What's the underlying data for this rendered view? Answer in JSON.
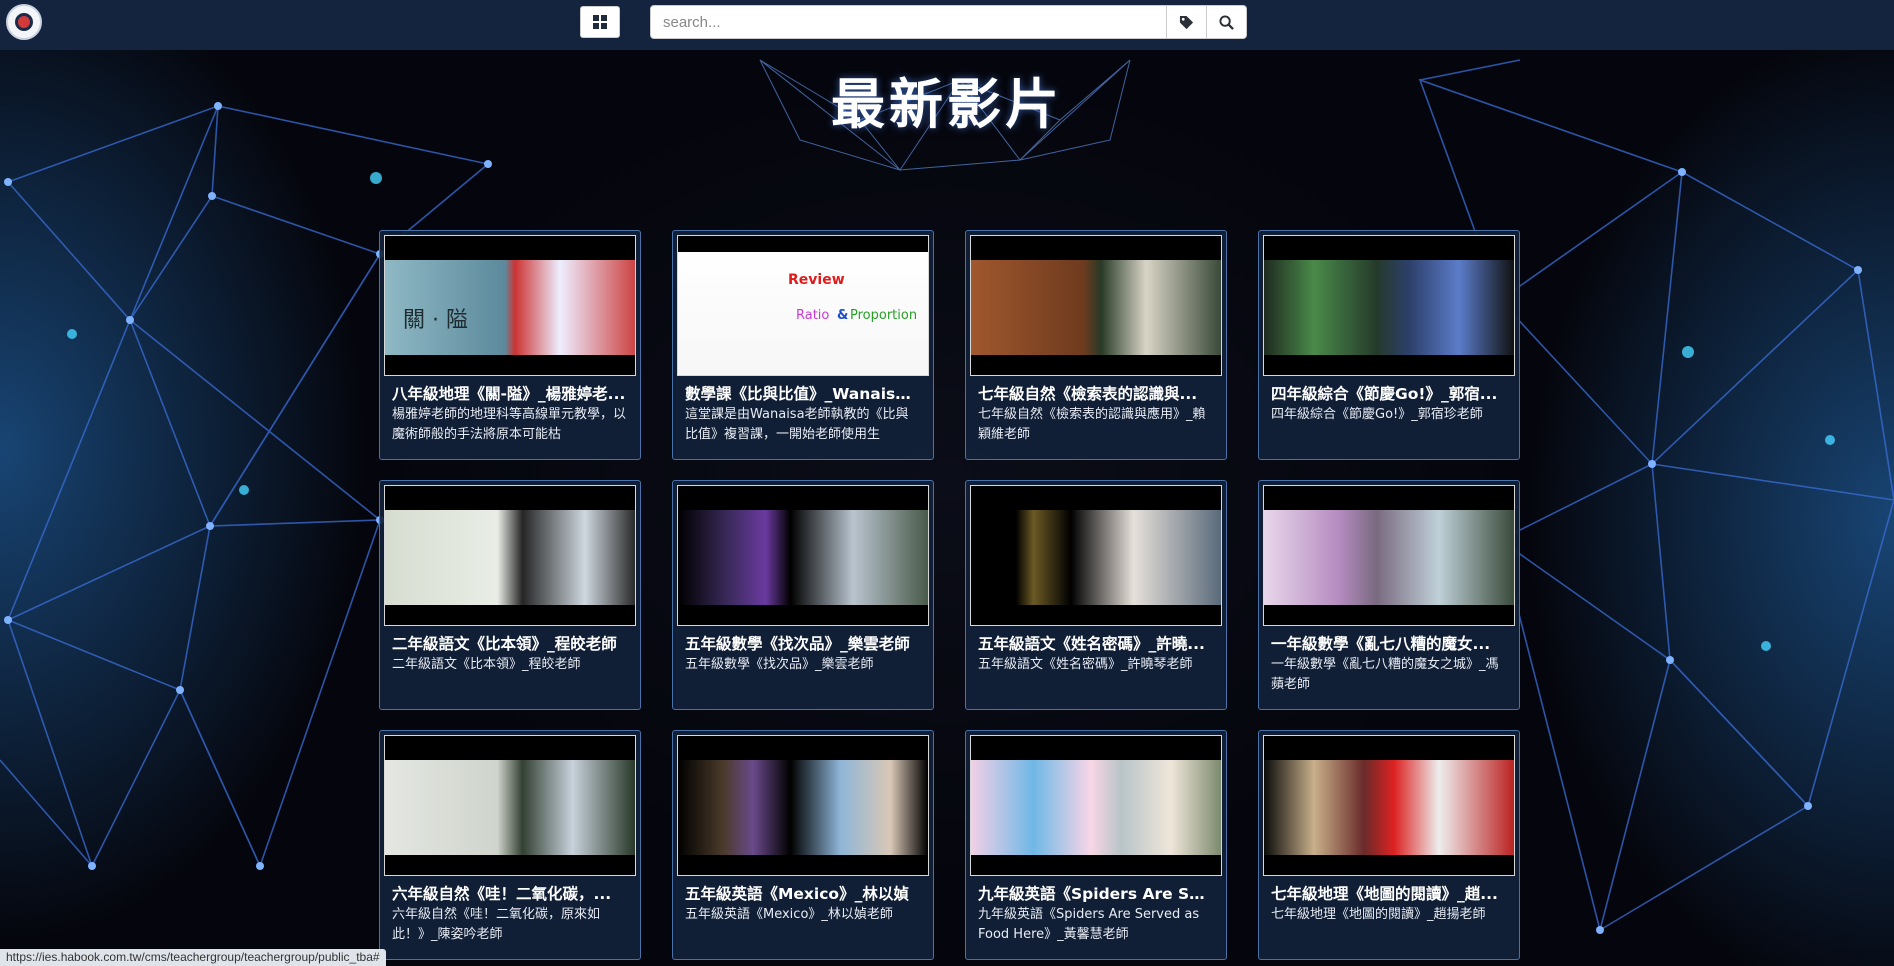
{
  "header": {
    "search_placeholder": "search...",
    "icons": {
      "grid": "grid-icon",
      "tag": "tag-icon",
      "search": "search-icon"
    }
  },
  "page_title": "最新影片",
  "videos": [
    {
      "title": "八年級地理《關-隘》_楊雅婷老...",
      "desc": "楊雅婷老師的地理科等高線單元教學，以魔術師般的手法將原本可能枯",
      "scene": "mountain",
      "thumb_text": "關 · 隘"
    },
    {
      "title": "數學課《比與比值》_Wanaisa...",
      "desc": "這堂課是由Wanaisa老師執教的《比與比值》複習課，一開始老師使用生",
      "scene": "slide",
      "thumb_text": "Review",
      "thumb_text2": "Ratio",
      "thumb_text3": "Proportion"
    },
    {
      "title": "七年級自然《檢索表的認識與...",
      "desc": "七年級自然《檢索表的認識與應用》_賴穎維老師",
      "scene": "desert"
    },
    {
      "title": "四年級綜合《節慶Go!》_郭宿...",
      "desc": "四年級綜合《節慶Go!》_郭宿珍老師",
      "scene": "green"
    },
    {
      "title": "二年級語文《比本領》_程皎老師",
      "desc": "二年級語文《比本領》_程皎老師",
      "scene": "map"
    },
    {
      "title": "五年級數學《找次品》_樂雲老師",
      "desc": "五年級數學《找次品》_樂雲老師",
      "scene": "stage"
    },
    {
      "title": "五年級語文《姓名密碼》_許曉...",
      "desc": "五年級語文《姓名密碼》_許曉琴老師",
      "scene": "stage2"
    },
    {
      "title": "一年級數學《亂七八糟的魔女...",
      "desc": "一年級數學《亂七八糟的魔女之城》_馮蘋老師",
      "scene": "purple"
    },
    {
      "title": "六年級自然《哇！二氧化碳，...",
      "desc": "六年級自然《哇！二氧化碳，原來如此！》_陳姿吟老師",
      "scene": "classroom"
    },
    {
      "title": "五年級英語《Mexico》_林以媜",
      "desc": "五年級英語《Mexico》_林以媜老師",
      "scene": "stage3"
    },
    {
      "title": "九年級英語《Spiders Are Ser...",
      "desc": "九年級英語《Spiders Are Served as Food Here》_黃馨慧老師",
      "scene": "poster"
    },
    {
      "title": "七年級地理《地圖的閱讀》_趙...",
      "desc": "七年級地理《地圖的閱讀》_趙揚老師",
      "scene": "red"
    }
  ],
  "status_url": "https://ies.habook.com.tw/cms/teachergroup/teachergroup/public_tba#"
}
